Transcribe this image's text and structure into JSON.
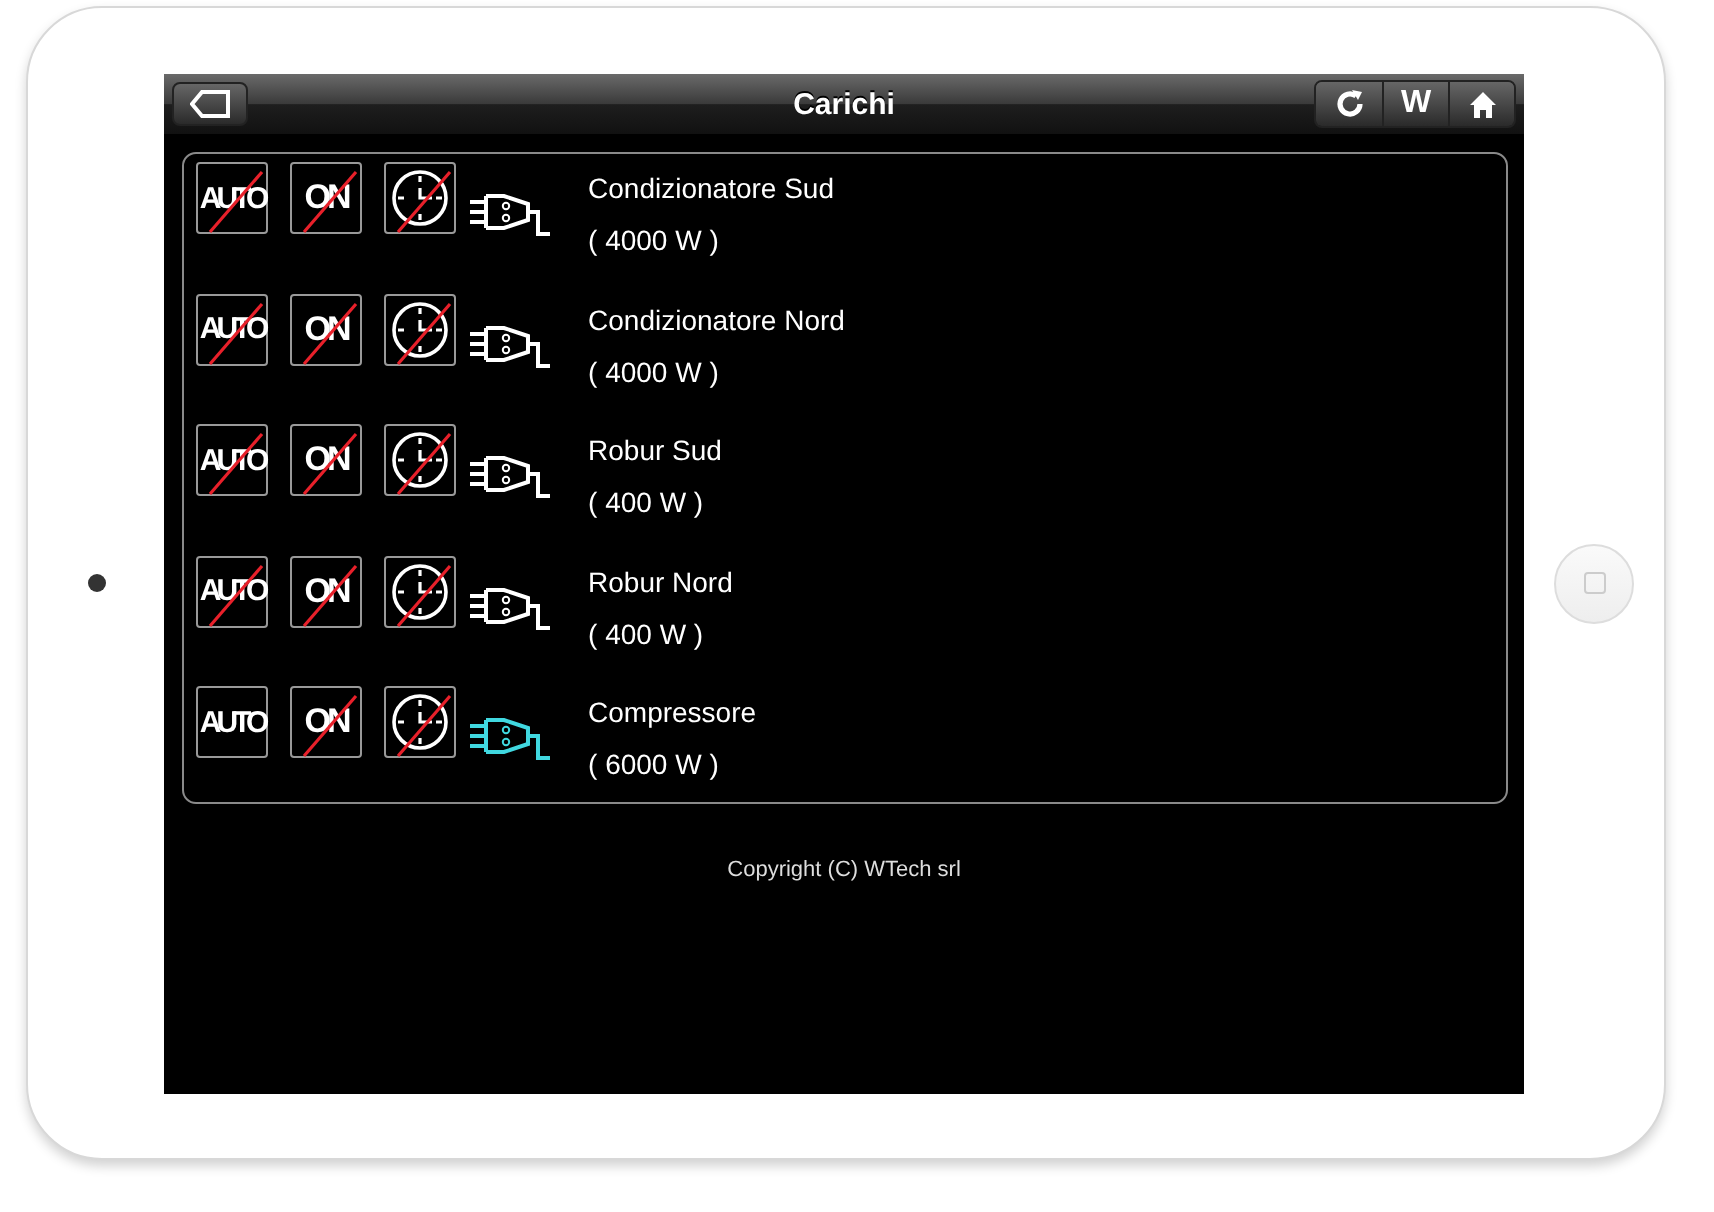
{
  "header": {
    "title": "Carichi",
    "right_buttons": [
      {
        "kind": "refresh"
      },
      {
        "kind": "text",
        "label": "W"
      },
      {
        "kind": "home"
      }
    ]
  },
  "loads": [
    {
      "name": "Condizionatore Sud",
      "power": "( 4000 W )",
      "auto_label": "AUTO",
      "auto": false,
      "on_label": "ON",
      "on": false,
      "timer": false,
      "active": false
    },
    {
      "name": "Condizionatore Nord",
      "power": "( 4000 W )",
      "auto_label": "AUTO",
      "auto": false,
      "on_label": "ON",
      "on": false,
      "timer": false,
      "active": false
    },
    {
      "name": "Robur Sud",
      "power": "( 400 W )",
      "auto_label": "AUTO",
      "auto": false,
      "on_label": "ON",
      "on": false,
      "timer": false,
      "active": false
    },
    {
      "name": "Robur Nord",
      "power": "( 400 W )",
      "auto_label": "AUTO",
      "auto": false,
      "on_label": "ON",
      "on": false,
      "timer": false,
      "active": false
    },
    {
      "name": "Compressore",
      "power": "( 6000 W )",
      "auto_label": "AUTO",
      "auto": true,
      "on_label": "ON",
      "on": false,
      "timer": false,
      "active": true
    }
  ],
  "footer": "Copyright (C) WTech srl"
}
